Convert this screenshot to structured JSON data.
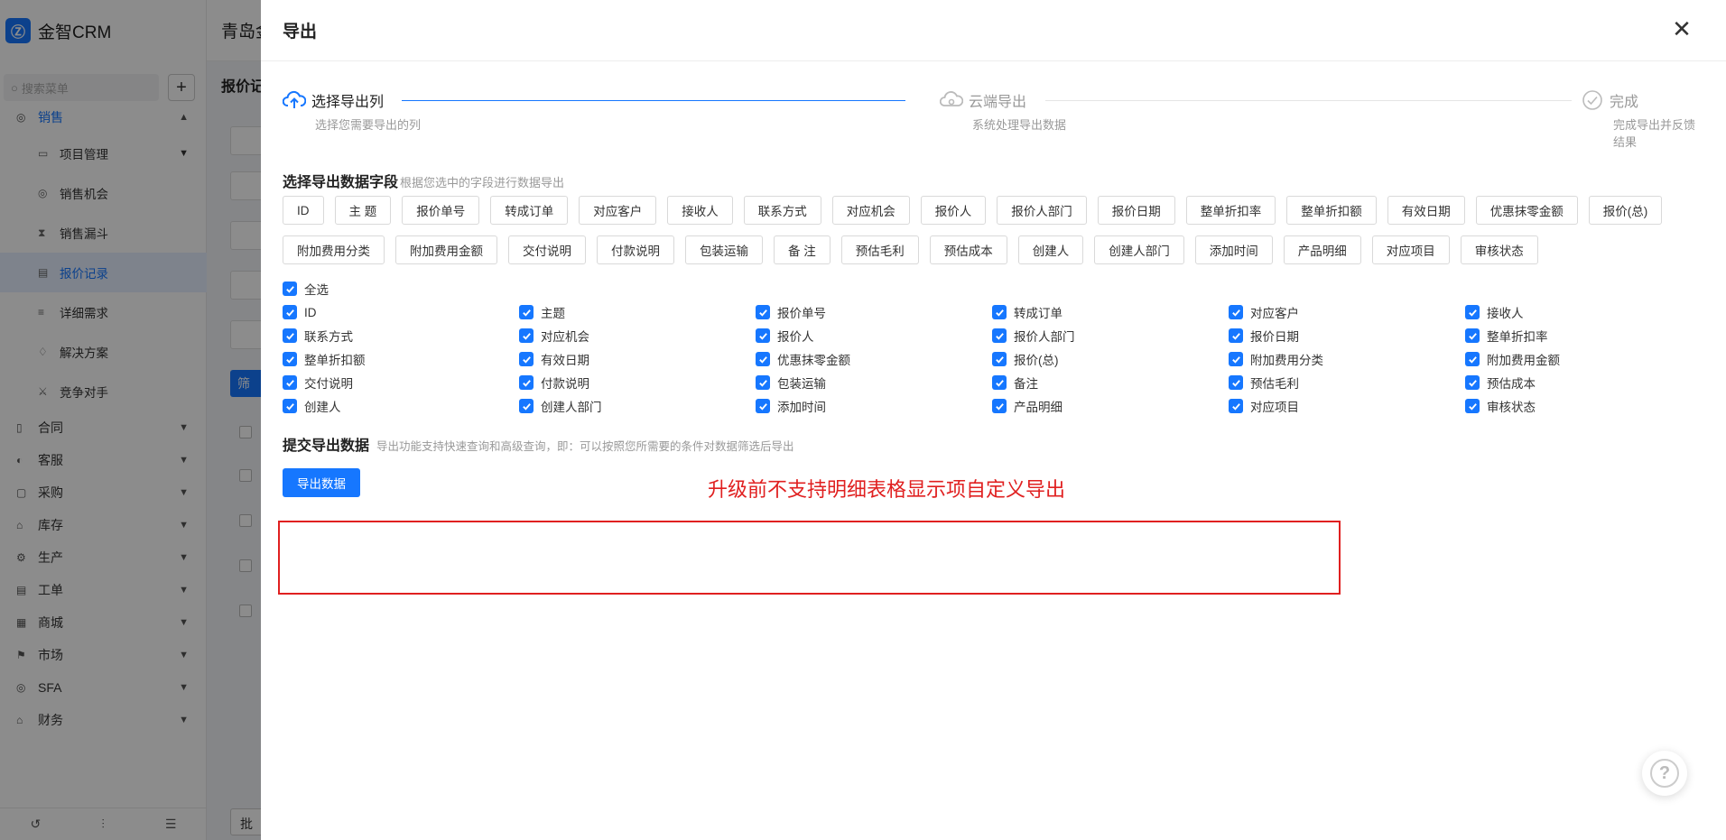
{
  "app": {
    "brand": "金智CRM",
    "topbar_title": "青岛金",
    "search_placeholder": "搜索菜单",
    "bg_title": "报价记",
    "bg_filter_btn": "筛",
    "bg_batch_btn": "批"
  },
  "sidebar": {
    "groups_top": [
      {
        "label": "销售",
        "icon": "target-icon"
      }
    ],
    "sales_items": [
      {
        "label": "项目管理",
        "has_chevron": true
      },
      {
        "label": "销售机会"
      },
      {
        "label": "销售漏斗"
      },
      {
        "label": "报价记录",
        "selected": true
      },
      {
        "label": "详细需求"
      },
      {
        "label": "解决方案"
      },
      {
        "label": "竞争对手"
      }
    ],
    "groups": [
      {
        "label": "合同"
      },
      {
        "label": "客服"
      },
      {
        "label": "采购"
      },
      {
        "label": "库存"
      },
      {
        "label": "生产"
      },
      {
        "label": "工单"
      },
      {
        "label": "商城"
      },
      {
        "label": "市场"
      },
      {
        "label": "SFA"
      },
      {
        "label": "财务"
      }
    ]
  },
  "drawer": {
    "title": "导出",
    "close_icon": "close-icon",
    "steps": [
      {
        "title": "选择导出列",
        "desc": "选择您需要导出的列",
        "status": "active"
      },
      {
        "title": "云端导出",
        "desc": "系统处理导出数据",
        "status": "wait"
      },
      {
        "title": "完成",
        "desc": "完成导出并反馈结果",
        "status": "wait"
      }
    ],
    "fields_section": {
      "title": "选择导出数据字段",
      "hint": "根据您选中的字段进行数据导出"
    },
    "tags": [
      "ID",
      "主 题",
      "报价单号",
      "转成订单",
      "对应客户",
      "接收人",
      "联系方式",
      "对应机会",
      "报价人",
      "报价人部门",
      "报价日期",
      "整单折扣率",
      "整单折扣额",
      "有效日期",
      "优惠抹零金额",
      "报价(总)",
      "附加费用分类",
      "附加费用金额",
      "交付说明",
      "付款说明",
      "包装运输",
      "备 注",
      "预估毛利",
      "预估成本",
      "创建人",
      "创建人部门",
      "添加时间",
      "产品明细",
      "对应项目",
      "审核状态"
    ],
    "select_all_label": "全选",
    "checkboxes": [
      "ID",
      "主题",
      "报价单号",
      "转成订单",
      "对应客户",
      "接收人",
      "联系方式",
      "对应机会",
      "报价人",
      "报价人部门",
      "报价日期",
      "整单折扣率",
      "整单折扣额",
      "有效日期",
      "优惠抹零金额",
      "报价(总)",
      "附加费用分类",
      "附加费用金额",
      "交付说明",
      "付款说明",
      "包装运输",
      "备注",
      "预估毛利",
      "预估成本",
      "创建人",
      "创建人部门",
      "添加时间",
      "产品明细",
      "对应项目",
      "审核状态"
    ],
    "submit_section": {
      "title": "提交导出数据",
      "hint": "导出功能支持快速查询和高级查询，即：可以按照您所需要的条件对数据筛选后导出"
    },
    "export_button": "导出数据",
    "annotation": "升级前不支持明细表格显示项自定义导出",
    "help_icon": "?"
  },
  "colors": {
    "primary": "#1677ff",
    "annotation": "#e02020"
  }
}
